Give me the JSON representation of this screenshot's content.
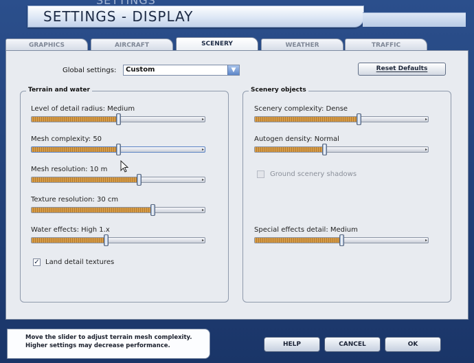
{
  "window": {
    "title": "SETTINGS - DISPLAY",
    "ghost_title": "SETTINGS"
  },
  "tabs": [
    {
      "label": "GRAPHICS",
      "active": false
    },
    {
      "label": "AIRCRAFT",
      "active": false
    },
    {
      "label": "SCENERY",
      "active": true
    },
    {
      "label": "WEATHER",
      "active": false
    },
    {
      "label": "TRAFFIC",
      "active": false
    }
  ],
  "global": {
    "label": "Global settings:",
    "value": "Custom"
  },
  "reset_label": "Reset Defaults",
  "terrain": {
    "title": "Terrain and water",
    "sliders": [
      {
        "label": "Level of detail radius: Medium",
        "fraction": 0.5
      },
      {
        "label": "Mesh complexity: 50",
        "fraction": 0.5,
        "focused": true
      },
      {
        "label": "Mesh resolution: 10 m",
        "fraction": 0.62
      },
      {
        "label": "Texture resolution: 30 cm",
        "fraction": 0.7
      },
      {
        "label": "Water effects: High 1.x",
        "fraction": 0.43
      }
    ],
    "checkbox": {
      "label": "Land detail textures",
      "checked": true
    }
  },
  "scenery": {
    "title": "Scenery objects",
    "sliders": [
      {
        "label": "Scenery complexity: Dense",
        "fraction": 0.6
      },
      {
        "label": "Autogen density: Normal",
        "fraction": 0.4
      },
      {
        "label": "Special effects detail: Medium",
        "fraction": 0.5
      }
    ],
    "checkbox": {
      "label": "Ground scenery shadows",
      "checked": false,
      "disabled": true
    }
  },
  "hint": {
    "line1": "Move the slider to adjust terrain mesh complexity.",
    "line2": "Higher settings may decrease performance."
  },
  "buttons": {
    "help": "HELP",
    "cancel": "CANCEL",
    "ok": "OK"
  },
  "icons": {
    "dropdown": "chevron-down-icon",
    "check": "checkmark-icon",
    "cursor": "mouse-pointer-icon"
  }
}
